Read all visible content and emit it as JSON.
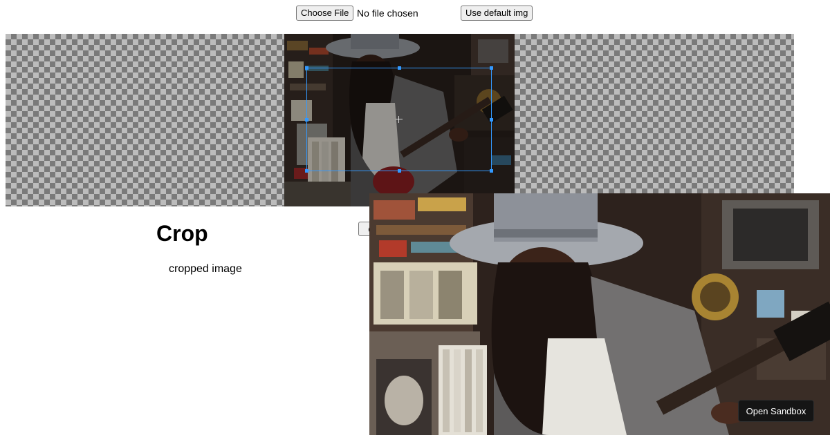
{
  "file_input": {
    "button_label": "Choose File",
    "status": "No file chosen"
  },
  "toolbar": {
    "default_img_label": "Use default img"
  },
  "cropper": {
    "photo": "photo of a woman in a striped fedora playing a red electric guitar in a record store"
  },
  "result": {
    "heading": "Crop",
    "image_alt": "cropped image",
    "hidden_button_label": "C"
  },
  "sandbox": {
    "label": "Open Sandbox"
  },
  "colors": {
    "crop_box": "#3399ff",
    "sandbox_bg": "#151515"
  }
}
